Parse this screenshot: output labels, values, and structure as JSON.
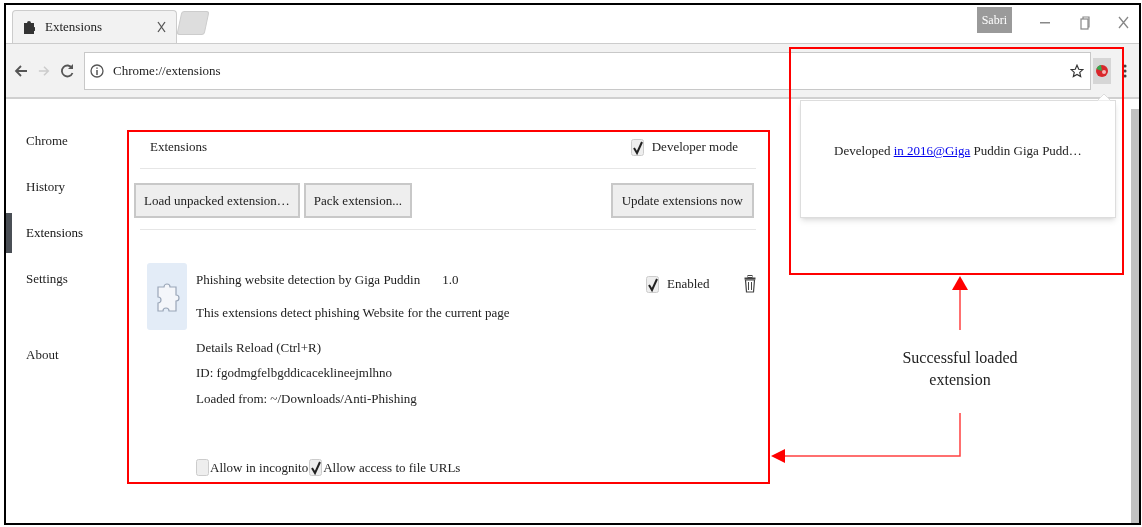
{
  "window": {
    "tabs": [
      {
        "title": "Extensions",
        "selected": true
      }
    ],
    "profile": "Sabri"
  },
  "toolbar": {
    "address": "Chrome://extensions"
  },
  "sidebar": {
    "items": [
      {
        "label": "Chrome",
        "selected": false
      },
      {
        "label": "History",
        "selected": false
      },
      {
        "label": "Extensions",
        "selected": true
      },
      {
        "label": "Settings",
        "selected": false
      },
      {
        "label": "About",
        "selected": false
      }
    ]
  },
  "page": {
    "title": "Extensions",
    "developer_mode": {
      "label": "Developer mode",
      "checked": true
    },
    "buttons": [
      {
        "label": "Load unpacked extension…",
        "kind": "left"
      },
      {
        "label": "Pack extension...",
        "kind": "left"
      },
      {
        "label": "Update extensions now",
        "kind": "right"
      }
    ],
    "extension": {
      "name": "Phishing website detection by Giga Puddin",
      "version": "1.0",
      "description": "This extensions detect phishing Website for the current page",
      "links": "Details Reload (Ctrl+R)",
      "id": "ID: fgodmgfelbgddicaceklineejmlhno",
      "loaded_from": "Loaded from: ~/Downloads/Anti-Phishing",
      "enabled": {
        "label": "Enabled",
        "checked": true
      },
      "options": [
        {
          "label": "Allow in incognito",
          "checked": false
        },
        {
          "label": "Allow access to file URLs",
          "checked": true
        }
      ]
    }
  },
  "popup": {
    "text_before": "Developed",
    "link": "in 2016@Giga",
    "text_after": "Puddin Giga Pudd…"
  },
  "annotation": {
    "text": "Successful loaded extension"
  }
}
